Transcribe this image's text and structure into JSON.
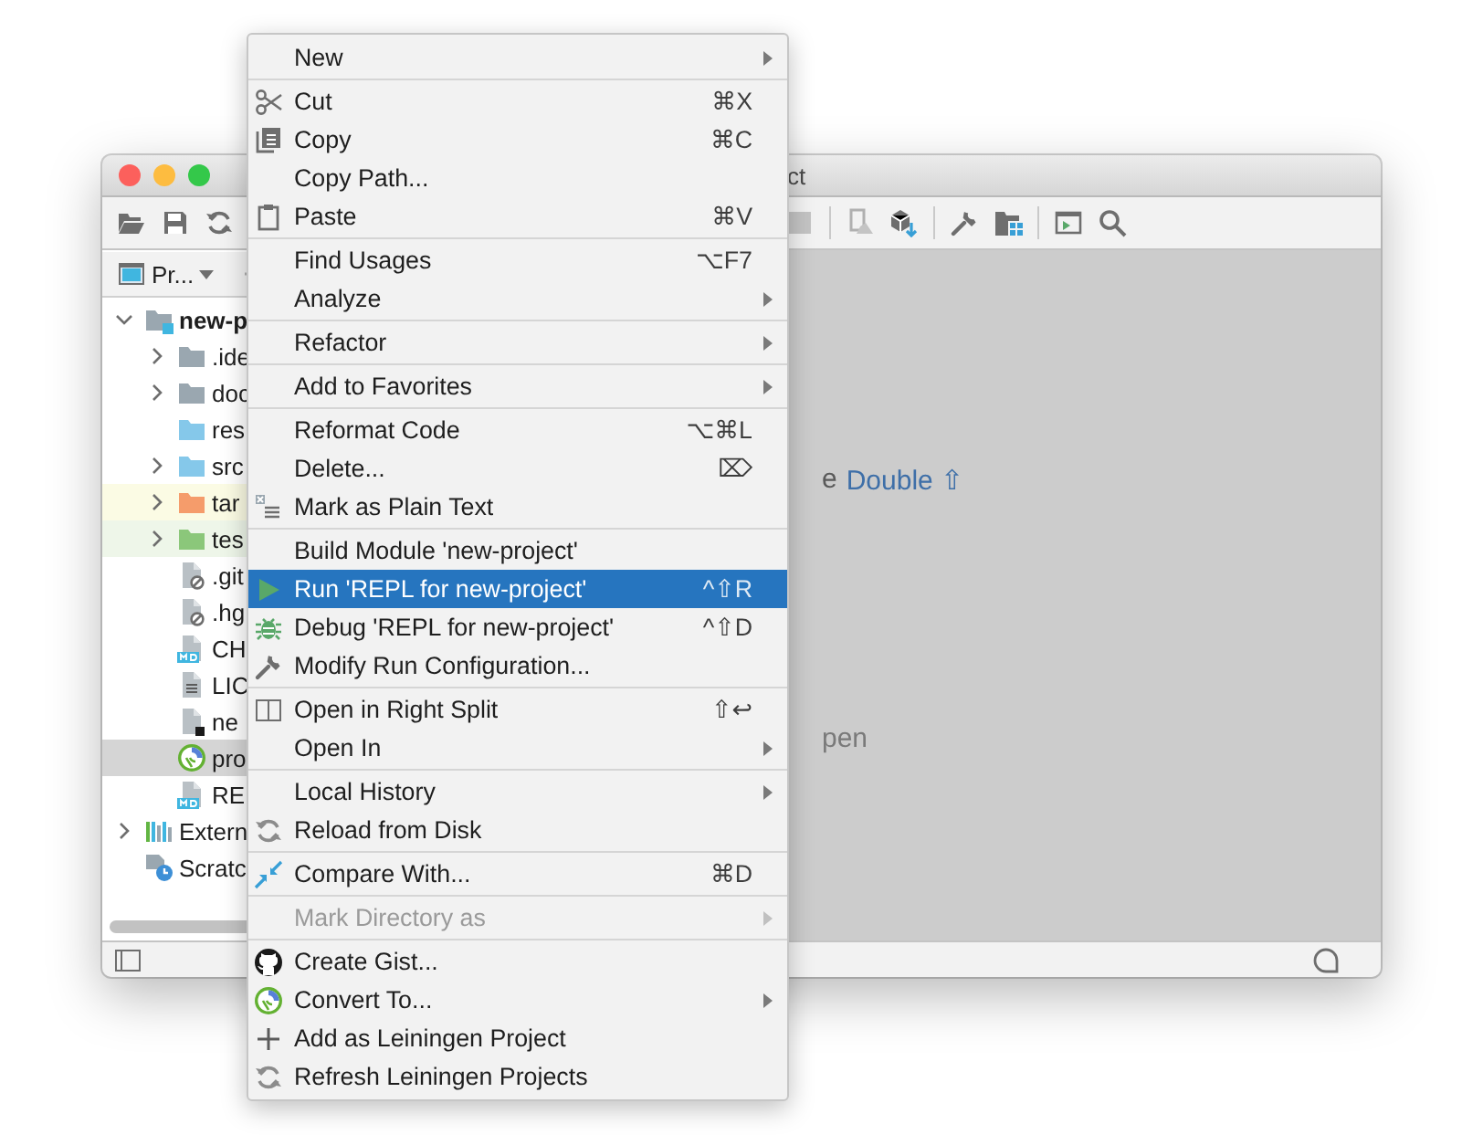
{
  "window": {
    "title": "ct"
  },
  "project_panel": {
    "view_selector": "Pr...",
    "tree": [
      {
        "label": "new-p",
        "expanded": true,
        "selected": false,
        "children": [
          {
            "label": ".ide",
            "expanded": false,
            "selected": false
          },
          {
            "label": "doc",
            "expanded": false,
            "selected": false
          },
          {
            "label": "res",
            "selected": false
          },
          {
            "label": "src",
            "expanded": false,
            "selected": false
          },
          {
            "label": "tar",
            "expanded": false,
            "selected": false,
            "color": "#fbfbe4"
          },
          {
            "label": "tes",
            "expanded": false,
            "selected": false,
            "color": "#eef6e9"
          },
          {
            "label": ".git",
            "selected": false
          },
          {
            "label": ".hg",
            "selected": false
          },
          {
            "label": "CH",
            "selected": false
          },
          {
            "label": "LIC",
            "selected": false
          },
          {
            "label": "ne",
            "selected": false
          },
          {
            "label": "pro",
            "selected": true
          },
          {
            "label": "RE",
            "selected": false
          }
        ]
      },
      {
        "label": "Extern",
        "expanded": false,
        "selected": false
      },
      {
        "label": "Scratc",
        "selected": false
      }
    ]
  },
  "editor": {
    "hint_lead": "e",
    "hint_shortcut": "Double ⇧",
    "hint_tail": "pen"
  },
  "context_menu": {
    "groups": [
      {
        "items": [
          {
            "label": "New",
            "submenu": true,
            "selected": false,
            "disabled": false
          }
        ]
      },
      {
        "items": [
          {
            "label": "Cut",
            "shortcut": "⌘X",
            "submenu": false,
            "selected": false,
            "disabled": false
          },
          {
            "label": "Copy",
            "shortcut": "⌘C",
            "submenu": false,
            "selected": false,
            "disabled": false
          },
          {
            "label": "Copy Path...",
            "submenu": false,
            "selected": false,
            "disabled": false
          },
          {
            "label": "Paste",
            "shortcut": "⌘V",
            "submenu": false,
            "selected": false,
            "disabled": false
          }
        ]
      },
      {
        "items": [
          {
            "label": "Find Usages",
            "shortcut": "⌥F7",
            "submenu": false,
            "selected": false,
            "disabled": false
          },
          {
            "label": "Analyze",
            "submenu": true,
            "selected": false,
            "disabled": false
          }
        ]
      },
      {
        "items": [
          {
            "label": "Refactor",
            "submenu": true,
            "selected": false,
            "disabled": false
          }
        ]
      },
      {
        "items": [
          {
            "label": "Add to Favorites",
            "submenu": true,
            "selected": false,
            "disabled": false
          }
        ]
      },
      {
        "items": [
          {
            "label": "Reformat Code",
            "shortcut": "⌥⌘L",
            "submenu": false,
            "selected": false,
            "disabled": false
          },
          {
            "label": "Delete...",
            "shortcut": "⌦",
            "submenu": false,
            "selected": false,
            "disabled": false
          },
          {
            "label": "Mark as Plain Text",
            "submenu": false,
            "selected": false,
            "disabled": false
          }
        ]
      },
      {
        "items": [
          {
            "label": "Build Module 'new-project'",
            "submenu": false,
            "selected": false,
            "disabled": false
          },
          {
            "label": "Run 'REPL for new-project'",
            "shortcut": "^⇧R",
            "submenu": false,
            "selected": true,
            "disabled": false
          },
          {
            "label": "Debug 'REPL for new-project'",
            "shortcut": "^⇧D",
            "submenu": false,
            "selected": false,
            "disabled": false
          },
          {
            "label": "Modify Run Configuration...",
            "submenu": false,
            "selected": false,
            "disabled": false
          }
        ]
      },
      {
        "items": [
          {
            "label": "Open in Right Split",
            "shortcut": "⇧↩",
            "submenu": false,
            "selected": false,
            "disabled": false
          },
          {
            "label": "Open In",
            "submenu": true,
            "selected": false,
            "disabled": false
          }
        ]
      },
      {
        "items": [
          {
            "label": "Local History",
            "submenu": true,
            "selected": false,
            "disabled": false
          },
          {
            "label": "Reload from Disk",
            "submenu": false,
            "selected": false,
            "disabled": false
          }
        ]
      },
      {
        "items": [
          {
            "label": "Compare With...",
            "shortcut": "⌘D",
            "submenu": false,
            "selected": false,
            "disabled": false
          }
        ]
      },
      {
        "items": [
          {
            "label": "Mark Directory as",
            "submenu": true,
            "selected": false,
            "disabled": true
          }
        ]
      },
      {
        "items": [
          {
            "label": "Create Gist...",
            "submenu": false,
            "selected": false,
            "disabled": false
          },
          {
            "label": "Convert To...",
            "submenu": true,
            "selected": false,
            "disabled": false
          },
          {
            "label": "Add as Leiningen Project",
            "submenu": false,
            "selected": false,
            "disabled": false
          },
          {
            "label": "Refresh Leiningen Projects",
            "submenu": false,
            "selected": false,
            "disabled": false
          }
        ]
      }
    ]
  }
}
